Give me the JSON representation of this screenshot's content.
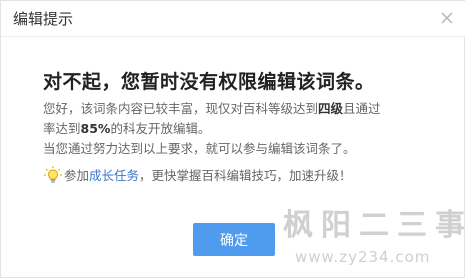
{
  "dialog": {
    "title": "编辑提示",
    "close_icon": "close-icon"
  },
  "content": {
    "headline": "对不起，您暂时没有权限编辑该词条。",
    "line1_pre": "您好，该词条内容已较丰富，现仅对百科等级达到",
    "level": "四级",
    "line1_post": "且通过",
    "line2_pre": "率达到",
    "rate": "85%",
    "line2_post": "的科友开放编辑。",
    "line3": "当您通过努力达到以上要求，就可以参与编辑该词条了。",
    "tip_icon": "lightbulb-icon",
    "tip_pre": "参加",
    "tip_link": "成长任务",
    "tip_post": "，更快掌握百科编辑技巧，加速升级！"
  },
  "buttons": {
    "confirm": "确定"
  },
  "watermark": {
    "chars": "枫阳二三事",
    "url": "www.zy234.com"
  },
  "colors": {
    "button_bg": "#4f9cee",
    "link": "#3a76c8",
    "headline": "#222222",
    "body_text": "#666666"
  }
}
